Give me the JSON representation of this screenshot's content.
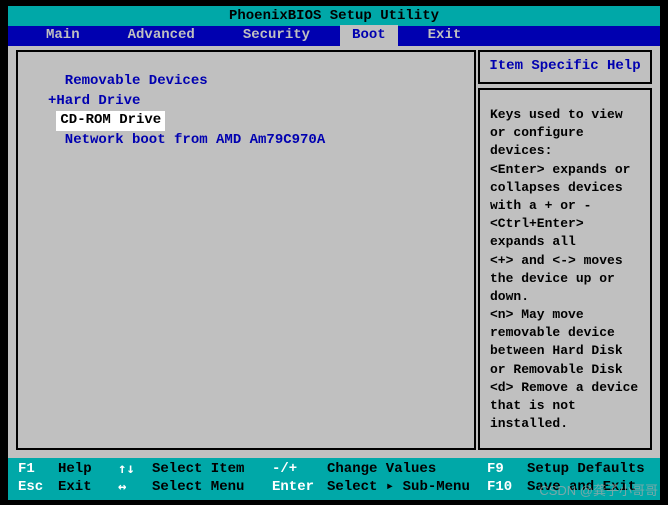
{
  "title": "PhoenixBIOS Setup Utility",
  "tabs": {
    "main": "Main",
    "advanced": "Advanced",
    "security": "Security",
    "boot": "Boot",
    "exit": "Exit"
  },
  "boot": {
    "items": [
      " Removable Devices",
      "+Hard Drive",
      "CD-ROM Drive",
      " Network boot from AMD Am79C970A"
    ]
  },
  "help": {
    "title": "Item Specific Help",
    "body": "Keys used to view or configure devices:\n<Enter> expands or collapses devices with a + or -\n<Ctrl+Enter> expands all\n<+> and <-> moves the device up or down.\n<n> May move removable device between Hard Disk or Removable Disk\n<d> Remove a device that is not installed."
  },
  "footer": {
    "r1": {
      "k1": "F1",
      "l1": "Help",
      "k2": "↑↓",
      "l2": "Select Item",
      "k3": "-/+",
      "l3": "Change Values",
      "k4": "F9",
      "l4": "Setup Defaults"
    },
    "r2": {
      "k1": "Esc",
      "l1": "Exit",
      "k2": "↔",
      "l2": "Select Menu",
      "k3": "Enter",
      "l3": "Select ▸ Sub-Menu",
      "k4": "F10",
      "l4": "Save and Exit"
    }
  },
  "watermark": "CSDN @龚子小哥哥"
}
